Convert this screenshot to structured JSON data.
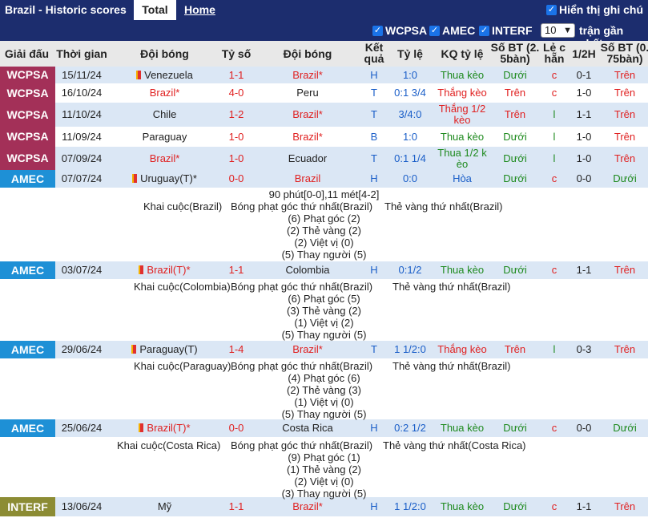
{
  "topbar": {
    "title": "Brazil - Historic scores",
    "tab_total": "Total",
    "tab_home": "Home",
    "notes_label": "Hiển thị ghi chú"
  },
  "filters": {
    "f1": "WCPSA",
    "f2": "AMEC",
    "f3": "INTERF",
    "count": "10",
    "recent": "trận gần nhất"
  },
  "headers": {
    "league": "Giải đấu",
    "time": "Thời gian",
    "team": "Đội bóng",
    "score": "Tỷ số",
    "team2": "Đội bóng",
    "result_l1": "Kết",
    "result_l2": "quả",
    "odds": "Tỷ lệ",
    "odds_res": "KQ tỷ lệ",
    "goals1_l1": "Số BT (2.",
    "goals1_l2": "5bàn)",
    "oddeven_l1": "Lẻ c",
    "oddeven_l2": "hẵn",
    "half": "1/2H",
    "goals2_l1": "Số BT (0.",
    "goals2_l2": "75bàn)"
  },
  "rows": [
    {
      "league": "WCPSA",
      "date": "15/11/24",
      "home": "Venezuela",
      "score": "1-1",
      "away": "Brazil*",
      "res": "H",
      "odds": "1:0",
      "kq": "Thua kèo",
      "bt": "Dưới",
      "le": "c",
      "half": "0-1",
      "bt2": "Trên"
    },
    {
      "league": "WCPSA",
      "date": "16/10/24",
      "home": "Brazil*",
      "score": "4-0",
      "away": "Peru",
      "res": "T",
      "odds": "0:1 3/4",
      "kq": "Thắng kèo",
      "bt": "Trên",
      "le": "c",
      "half": "1-0",
      "bt2": "Trên"
    },
    {
      "league": "WCPSA",
      "date": "11/10/24",
      "home": "Chile",
      "score": "1-2",
      "away": "Brazil*",
      "res": "T",
      "odds": "3/4:0",
      "kq1": "Thắng 1/2",
      "kq2": "kèo",
      "bt": "Trên",
      "le": "l",
      "half": "1-1",
      "bt2": "Trên"
    },
    {
      "league": "WCPSA",
      "date": "11/09/24",
      "home": "Paraguay",
      "score": "1-0",
      "away": "Brazil*",
      "res": "B",
      "odds": "1:0",
      "kq": "Thua kèo",
      "bt": "Dưới",
      "le": "l",
      "half": "1-0",
      "bt2": "Trên"
    },
    {
      "league": "WCPSA",
      "date": "07/09/24",
      "home": "Brazil*",
      "score": "1-0",
      "away": "Ecuador",
      "res": "T",
      "odds": "0:1 1/4",
      "kq1": "Thua 1/2 k",
      "kq2": "èo",
      "bt": "Dưới",
      "le": "l",
      "half": "1-0",
      "bt2": "Trên"
    },
    {
      "league": "AMEC",
      "date": "07/07/24",
      "home": "Uruguay(T)*",
      "score": "0-0",
      "away": "Brazil",
      "res": "H",
      "odds": "0:0",
      "kq": "Hòa",
      "bt": "Dưới",
      "le": "c",
      "half": "0-0",
      "bt2": "Dưới"
    },
    {
      "league": "AMEC",
      "date": "03/07/24",
      "home": "Brazil(T)*",
      "score": "1-1",
      "away": "Colombia",
      "res": "H",
      "odds": "0:1/2",
      "kq": "Thua kèo",
      "bt": "Dưới",
      "le": "c",
      "half": "1-1",
      "bt2": "Trên"
    },
    {
      "league": "AMEC",
      "date": "29/06/24",
      "home": "Paraguay(T)",
      "score": "1-4",
      "away": "Brazil*",
      "res": "T",
      "odds": "1 1/2:0",
      "kq": "Thắng kèo",
      "bt": "Trên",
      "le": "l",
      "half": "0-3",
      "bt2": "Trên"
    },
    {
      "league": "AMEC",
      "date": "25/06/24",
      "home": "Brazil(T)*",
      "score": "0-0",
      "away": "Costa Rica",
      "res": "H",
      "odds": "0:2 1/2",
      "kq": "Thua kèo",
      "bt": "Dưới",
      "le": "c",
      "half": "0-0",
      "bt2": "Dưới"
    },
    {
      "league": "INTERF",
      "date": "13/06/24",
      "home": "Mỹ",
      "score": "1-1",
      "away": "Brazil*",
      "res": "H",
      "odds": "1 1/2:0",
      "kq": "Thua kèo",
      "bt": "Dưới",
      "le": "c",
      "half": "1-1",
      "bt2": "Trên"
    }
  ],
  "details": [
    {
      "top": "90 phút[0-0],11 mét[4-2]",
      "kick": "Khai cuộc(Brazil)",
      "corner": "Bóng phạt góc thứ nhất(Brazil)",
      "yellow": "Thẻ vàng thứ nhất(Brazil)",
      "l1": "(6) Phạt góc (2)",
      "l2": "(2) Thẻ vàng (2)",
      "l3": "(2) Việt vị (0)",
      "l4": "(5) Thay người (5)"
    },
    {
      "kick": "Khai cuộc(Colombia)",
      "corner": "Bóng phạt góc thứ nhất(Brazil)",
      "yellow": "Thẻ vàng thứ nhất(Brazil)",
      "l1": "(6) Phạt góc (5)",
      "l2": "(3) Thẻ vàng (2)",
      "l3": "(1) Việt vị (2)",
      "l4": "(5) Thay người (5)"
    },
    {
      "kick": "Khai cuộc(Paraguay)",
      "corner": "Bóng phạt góc thứ nhất(Brazil)",
      "yellow": "Thẻ vàng thứ nhất(Brazil)",
      "l1": "(4) Phạt góc (6)",
      "l2": "(2) Thẻ vàng (3)",
      "l3": "(1) Việt vị (0)",
      "l4": "(5) Thay người (5)"
    },
    {
      "kick": "Khai cuộc(Costa Rica)",
      "corner": "Bóng phạt góc thứ nhất(Brazil)",
      "yellow": "Thẻ vàng thứ nhất(Costa Rica)",
      "l1": "(9) Phạt góc (1)",
      "l2": "(1) Thẻ vàng (2)",
      "l3": "(2) Việt vị (0)",
      "l4": "(3) Thay người (5)"
    }
  ],
  "colors": {
    "wcpsa": "#a33058",
    "amec": "#1e90d6",
    "interf": "#8c8c34",
    "red": "#e02020",
    "green": "#1e8a1e"
  }
}
